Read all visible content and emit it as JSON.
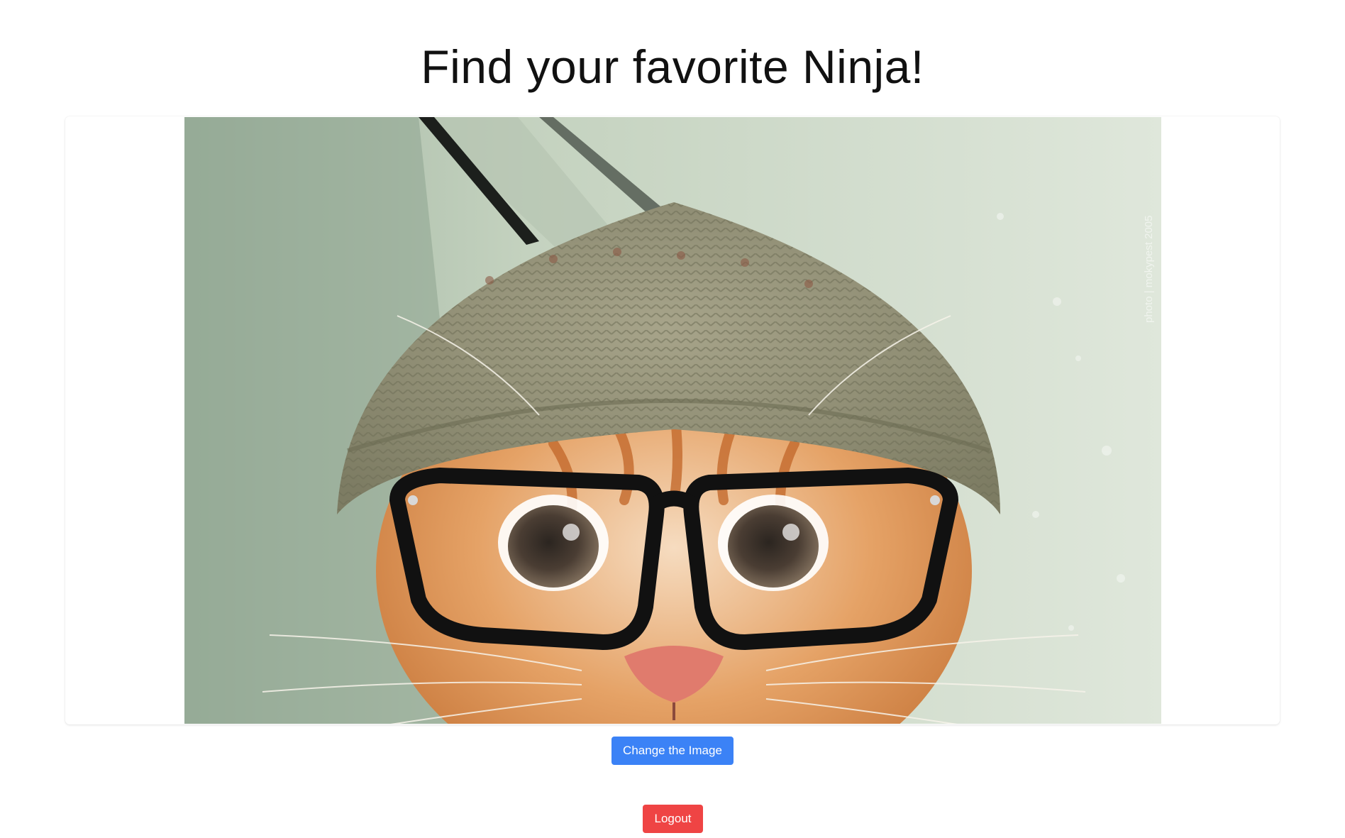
{
  "page": {
    "title": "Find your favorite Ninja!"
  },
  "image": {
    "alt": "Orange kitten wearing a knit beanie and black-rimmed glasses",
    "watermark": "photo | mokypest 2005"
  },
  "actions": {
    "change_image_label": "Change the Image",
    "logout_label": "Logout"
  },
  "colors": {
    "primary": "#3b82f6",
    "danger": "#ef4444",
    "title_text": "#111111",
    "background": "#ffffff"
  }
}
